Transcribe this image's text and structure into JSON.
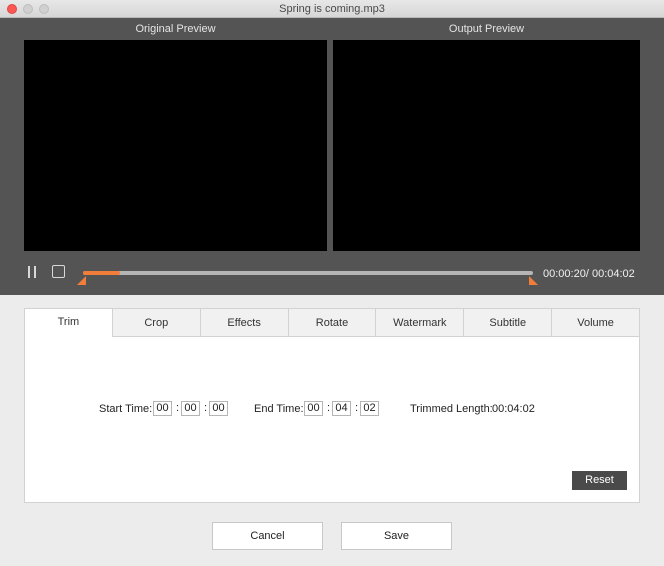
{
  "window": {
    "title": "Spring is coming.mp3"
  },
  "preview": {
    "original_label": "Original Preview",
    "output_label": "Output  Preview"
  },
  "playback": {
    "current_time": "00:00:20",
    "separator": "/",
    "total_time": "00:04:02",
    "progress_fraction": 0.083,
    "fill_color": "#f07d3a"
  },
  "tabs": [
    {
      "label": "Trim",
      "active": true
    },
    {
      "label": "Crop",
      "active": false
    },
    {
      "label": "Effects",
      "active": false
    },
    {
      "label": "Rotate",
      "active": false
    },
    {
      "label": "Watermark",
      "active": false
    },
    {
      "label": "Subtitle",
      "active": false
    },
    {
      "label": "Volume",
      "active": false
    }
  ],
  "trim": {
    "start_label": "Start Time:",
    "start": {
      "h": "00",
      "m": "00",
      "s": "00"
    },
    "end_label": "End Time:",
    "end": {
      "h": "00",
      "m": "04",
      "s": "02"
    },
    "length_label": "Trimmed Length:",
    "length_value": "00:04:02",
    "colon": ":",
    "reset_label": "Reset"
  },
  "footer": {
    "cancel_label": "Cancel",
    "save_label": "Save"
  }
}
